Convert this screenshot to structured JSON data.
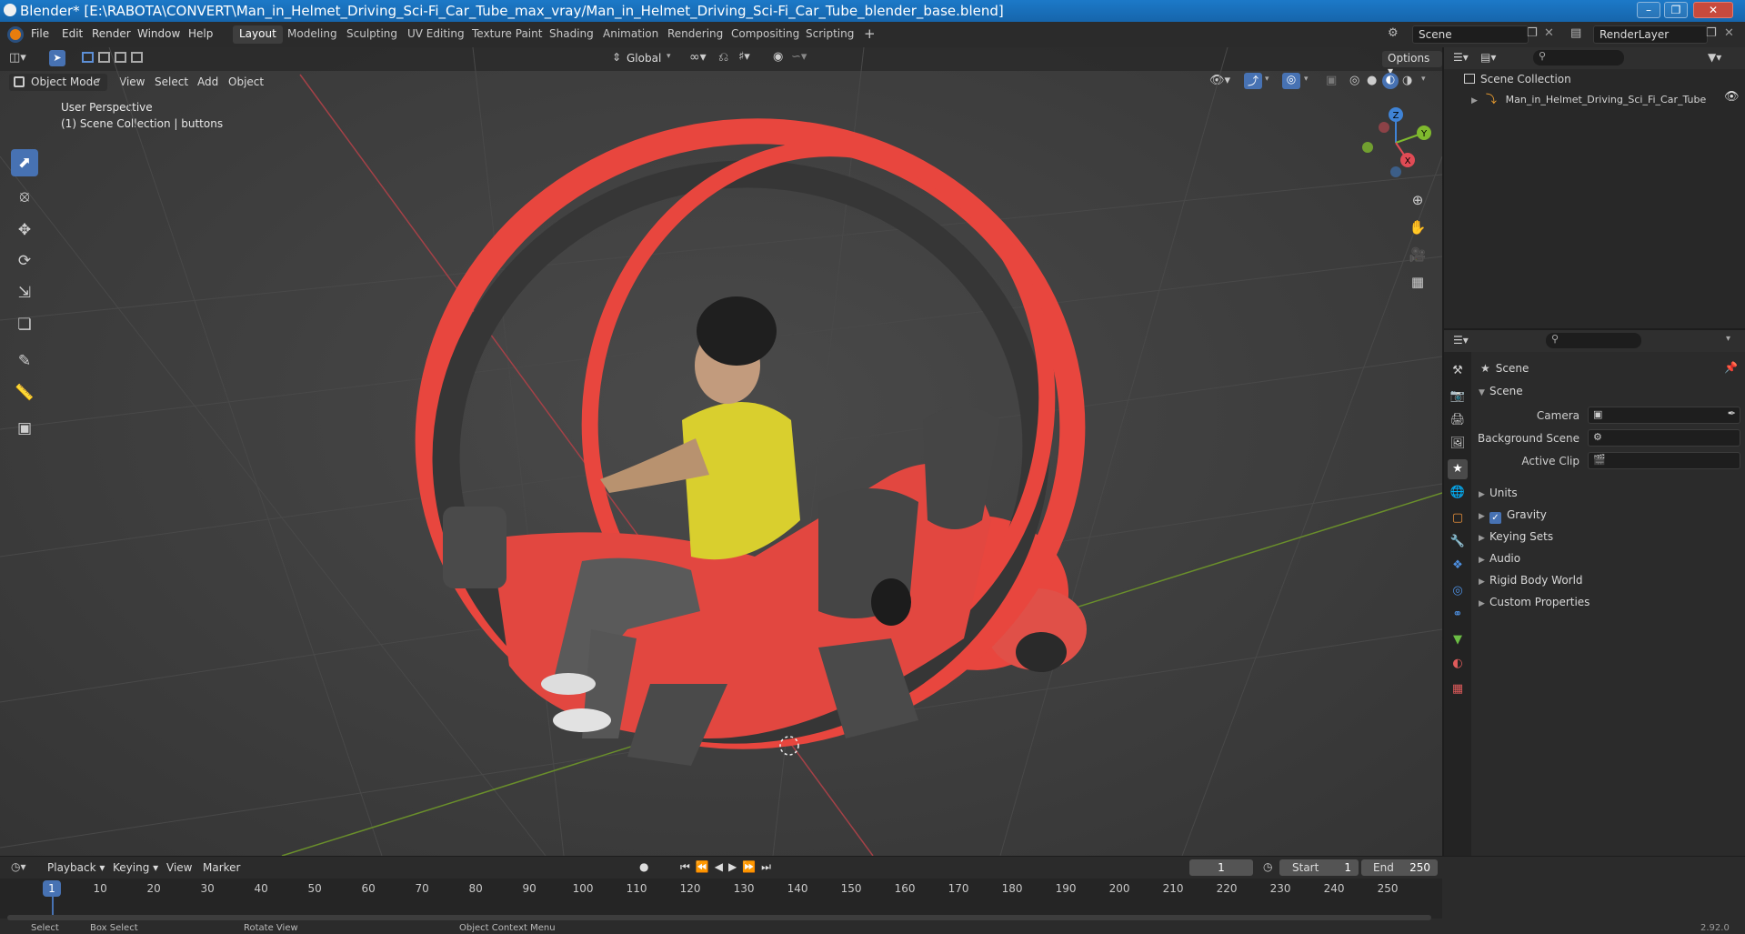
{
  "window": {
    "title": "Blender* [E:\\RABOTA\\CONVERT\\Man_in_Helmet_Driving_Sci-Fi_Car_Tube_max_vray/Man_in_Helmet_Driving_Sci-Fi_Car_Tube_blender_base.blend]"
  },
  "menu": [
    "File",
    "Edit",
    "Render",
    "Window",
    "Help"
  ],
  "workspaces": [
    "Layout",
    "Modeling",
    "Sculpting",
    "UV Editing",
    "Texture Paint",
    "Shading",
    "Animation",
    "Rendering",
    "Compositing",
    "Scripting"
  ],
  "scene_selector": {
    "value": "Scene",
    "renderlayer": "RenderLayer"
  },
  "viewport_header": {
    "mode": "Object Mode",
    "menus": [
      "View",
      "Select",
      "Add",
      "Object"
    ],
    "transform_orientation": "Global",
    "options": "Options"
  },
  "viewport": {
    "perspective": "User Perspective",
    "collection": "(1) Scene Collection | buttons",
    "gizmo": {
      "z": "Z",
      "y": "Y",
      "x": "X"
    }
  },
  "outliner": {
    "root": "Scene Collection",
    "items": [
      {
        "label": "Man_in_Helmet_Driving_Sci_Fi_Car_Tube"
      }
    ]
  },
  "properties": {
    "context": "Scene",
    "section": "Scene",
    "fields": [
      {
        "label": "Camera"
      },
      {
        "label": "Background Scene"
      },
      {
        "label": "Active Clip"
      }
    ],
    "panels": [
      {
        "label": "Units",
        "checkbox": false
      },
      {
        "label": "Gravity",
        "checkbox": true
      },
      {
        "label": "Keying Sets",
        "checkbox": false
      },
      {
        "label": "Audio",
        "checkbox": false
      },
      {
        "label": "Rigid Body World",
        "checkbox": false
      },
      {
        "label": "Custom Properties",
        "checkbox": false
      }
    ]
  },
  "timeline": {
    "menus": [
      "Playback",
      "Keying",
      "View",
      "Marker"
    ],
    "current_frame": "1",
    "start_label": "Start",
    "start": "1",
    "end_label": "End",
    "end": "250",
    "ruler": [
      "1",
      "10",
      "20",
      "30",
      "40",
      "50",
      "60",
      "70",
      "80",
      "90",
      "100",
      "110",
      "120",
      "130",
      "140",
      "150",
      "160",
      "170",
      "180",
      "190",
      "200",
      "210",
      "220",
      "230",
      "240",
      "250"
    ]
  },
  "statusbar": {
    "items": [
      "Select",
      "Box Select",
      "Rotate View",
      "Object Context Menu"
    ],
    "version": "2.92.0"
  },
  "colors": {
    "accent": "#4772b3",
    "car_red": "#e8463e",
    "shirt": "#d9cf2e",
    "axis_x": "#e04b55",
    "axis_y": "#7fb92e",
    "axis_z": "#3f83d6"
  }
}
